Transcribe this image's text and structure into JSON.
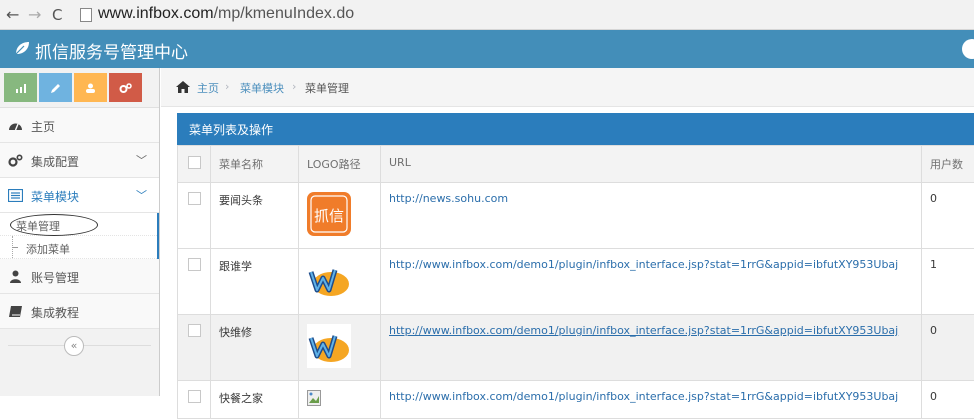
{
  "browser": {
    "url_host": "www.infbox.com",
    "url_path": "/mp/kmenuIndex.do"
  },
  "header": {
    "title": "抓信服务号管理中心"
  },
  "sidebar": {
    "shortcut_colors": [
      "#87b87f",
      "#6fb3e0",
      "#ffb752",
      "#d15b47"
    ],
    "items": [
      {
        "label": "主页",
        "icon": "dashboard-icon"
      },
      {
        "label": "集成配置",
        "icon": "cogs-icon"
      },
      {
        "label": "菜单模块",
        "icon": "list-icon"
      },
      {
        "label": "账号管理",
        "icon": "user-icon"
      },
      {
        "label": "集成教程",
        "icon": "book-icon"
      }
    ],
    "submenu": [
      {
        "label": "菜单管理"
      },
      {
        "label": "添加菜单"
      }
    ]
  },
  "breadcrumb": {
    "home": "主页",
    "module": "菜单模块",
    "current": "菜单管理",
    "sep": "›"
  },
  "panel": {
    "title": "菜单列表及操作"
  },
  "table": {
    "headers": [
      "菜单名称",
      "LOGO路径",
      "URL",
      "用户数"
    ],
    "rows": [
      {
        "name": "要闻头条",
        "url": "http://news.sohu.com",
        "users": "0",
        "logo": "zhuaxin-logo",
        "logo_text": "抓信"
      },
      {
        "name": "跟谁学",
        "url": "http://www.infbox.com/demo1/plugin/infbox_interface.jsp?stat=1rrG&appid=ibfutXY953Ubaj",
        "users": "1",
        "logo": "w-logo"
      },
      {
        "name": "快维修",
        "url": "http://www.infbox.com/demo1/plugin/infbox_interface.jsp?stat=1rrG&appid=ibfutXY953Ubaj",
        "users": "0",
        "logo": "w-logo"
      },
      {
        "name": "快餐之家",
        "url": "http://www.infbox.com/demo1/plugin/infbox_interface.jsp?stat=1rrG&appid=ibfutXY953Ubaj",
        "users": "0",
        "logo": "broken-image"
      }
    ]
  }
}
